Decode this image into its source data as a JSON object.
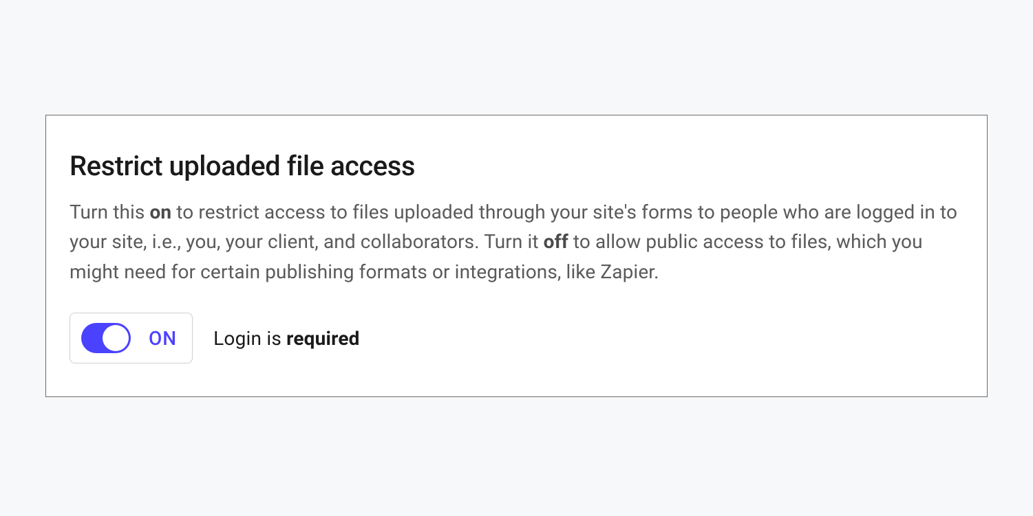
{
  "panel": {
    "title": "Restrict uploaded file access",
    "description": {
      "part1": "Turn this ",
      "bold1": "on",
      "part2": " to restrict access to files uploaded through your site's forms to people who are logged in to your site, i.e., you, your client, and collaborators. Turn it ",
      "bold2": "off",
      "part3": " to allow public access to files, which you might need for certain publishing formats or integrations, like Zapier."
    },
    "toggle": {
      "state": "ON",
      "enabled": true
    },
    "status": {
      "prefix": "Login is ",
      "value": "required"
    }
  },
  "colors": {
    "accent": "#4b42ff"
  }
}
